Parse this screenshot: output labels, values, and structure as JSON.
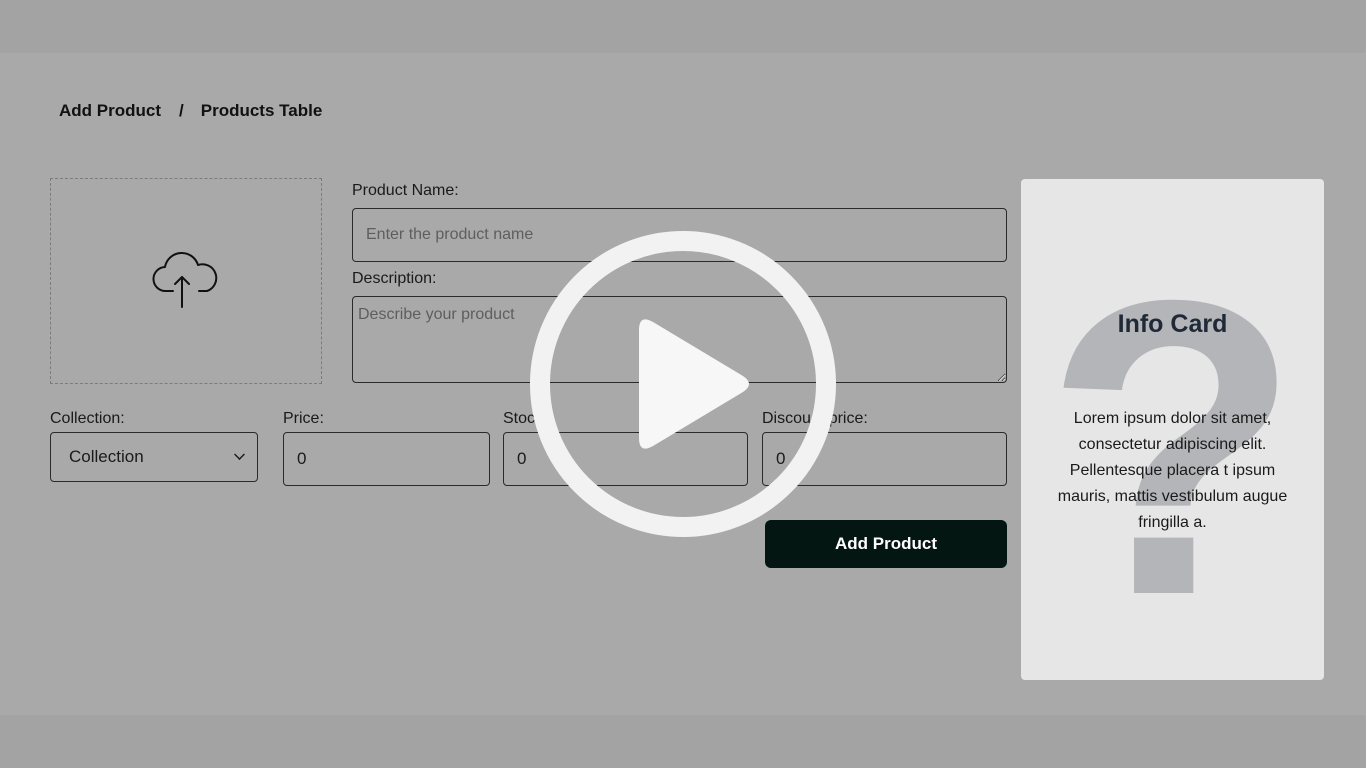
{
  "breadcrumb": {
    "current": "Add Product",
    "separator": "/",
    "link": "Products Table"
  },
  "upload": {
    "icon": "cloud-upload-icon"
  },
  "form": {
    "product_name_label": "Product Name:",
    "product_name_placeholder": "Enter the product name",
    "description_label": "Description:",
    "description_placeholder": "Describe your product",
    "collection_label": "Collection:",
    "collection_value": "Collection",
    "price_label": "Price:",
    "price_value": "0",
    "stock_label": "Stoc",
    "stock_value": "0",
    "discount_label": "Discou    price:",
    "discount_value": "0",
    "submit_label": "Add Product"
  },
  "info_card": {
    "title": "Info Card",
    "body": "Lorem ipsum dolor sit amet, consectetur adipiscing elit. Pellentesque placera t ipsum mauris, mattis vestibulum augue fringilla a.",
    "bg_glyph": "?"
  },
  "overlay": {
    "icon": "play-icon"
  },
  "colors": {
    "button_bg": "#031611",
    "card_bg": "#e6e6e6",
    "page_bg": "#a9a9a9"
  }
}
